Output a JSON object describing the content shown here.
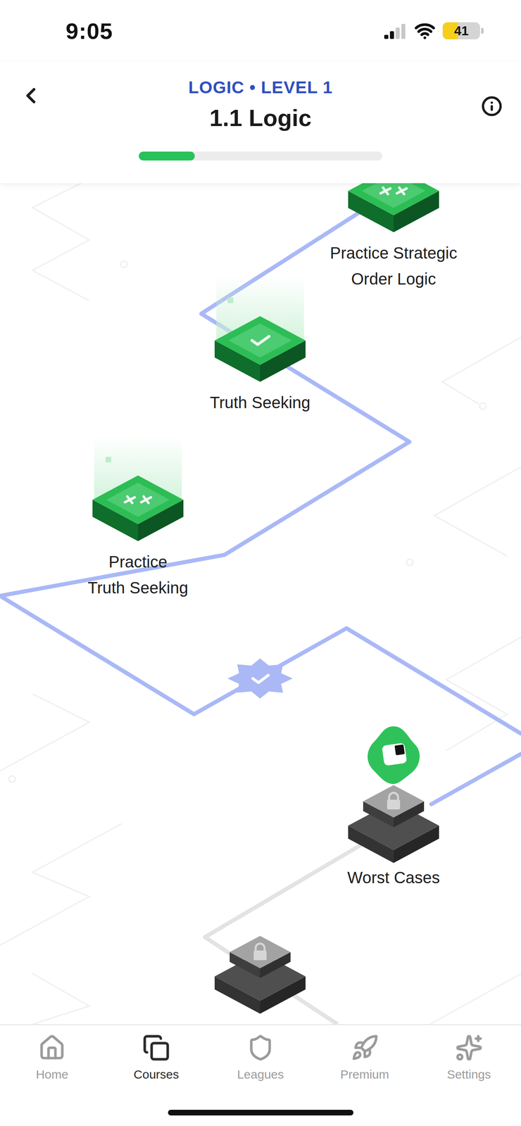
{
  "status_bar": {
    "time": "9:05",
    "signal_level": 0.5,
    "battery": {
      "text": "41",
      "level": 0.41
    }
  },
  "header": {
    "course": "LOGIC • LEVEL 1",
    "title": "1.1 Logic",
    "progress": {
      "level": 0.23
    }
  },
  "path_nodes": [
    {
      "kind": "practice",
      "lines": [
        "Practice Strategic",
        "Order Logic"
      ],
      "completed": true,
      "locked": false,
      "highlighted": false,
      "current": false
    },
    {
      "kind": "lesson",
      "lines": [
        "Truth Seeking"
      ],
      "completed": true,
      "locked": false,
      "highlighted": true,
      "current": false
    },
    {
      "kind": "practice",
      "lines": [
        "Practice",
        "Truth Seeking"
      ],
      "completed": true,
      "locked": false,
      "highlighted": true,
      "current": false
    },
    {
      "kind": "checkpoint",
      "lines": [],
      "completed": true,
      "locked": false,
      "highlighted": false,
      "current": false
    },
    {
      "kind": "lesson",
      "lines": [
        "Worst Cases"
      ],
      "completed": false,
      "locked": true,
      "highlighted": false,
      "current": true
    },
    {
      "kind": "lesson",
      "lines": [],
      "completed": false,
      "locked": true,
      "highlighted": false,
      "current": false
    }
  ],
  "nav": [
    {
      "label": "Home",
      "selected": false
    },
    {
      "label": "Courses",
      "selected": true
    },
    {
      "label": "Leagues",
      "selected": false
    },
    {
      "label": "Premium",
      "selected": false
    },
    {
      "label": "Settings",
      "selected": false
    }
  ]
}
